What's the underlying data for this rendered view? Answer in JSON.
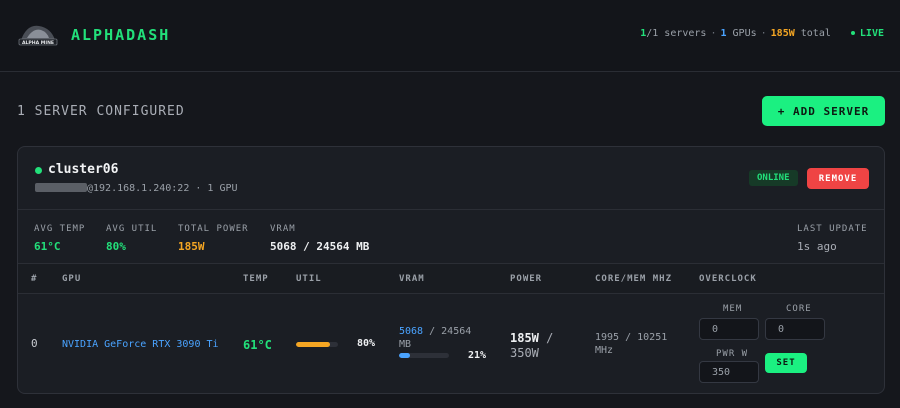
{
  "app": {
    "brand": "ALPHADASH",
    "logo_text": "ALPHA MINE",
    "stats": {
      "online": "1",
      "servers_total": "/1 servers",
      "gpus": "1",
      "gpus_label": " GPUs",
      "power": "185W",
      "power_label": " total",
      "live": "LIVE"
    }
  },
  "section": {
    "title": "1 SERVER CONFIGURED",
    "add_label": "+ ADD SERVER"
  },
  "server": {
    "name": "cluster06",
    "address": "@192.168.1.240:22 · 1 GPU",
    "status": "ONLINE",
    "remove_label": "REMOVE",
    "summary": {
      "avg_temp_label": "AVG TEMP",
      "avg_temp": "61°C",
      "avg_util_label": "AVG UTIL",
      "avg_util": "80%",
      "total_power_label": "TOTAL POWER",
      "total_power": "185W",
      "vram_label": "VRAM",
      "vram": "5068 / 24564 MB",
      "last_update_label": "LAST UPDATE",
      "last_update": "1s ago"
    },
    "columns": [
      "#",
      "GPU",
      "TEMP",
      "UTIL",
      "VRAM",
      "POWER",
      "CORE/MEM MHZ",
      "OVERCLOCK"
    ],
    "gpus": [
      {
        "index": "0",
        "name": "NVIDIA GeForce RTX 3090 Ti",
        "temp": "61°C",
        "util_pct": "80%",
        "util_fraction": 0.8,
        "vram_used": "5068",
        "vram_total": " / 24564 MB",
        "vram_pct": "21%",
        "vram_fraction": 0.21,
        "power_draw": "185W",
        "power_limit": " / 350W",
        "clocks": "1995 / 10251 MHz",
        "oc": {
          "mem_label": "MEM",
          "mem_value": "0",
          "core_label": "CORE",
          "core_value": "0",
          "pwr_label": "PWR W",
          "pwr_value": "350",
          "set_label": "SET"
        }
      }
    ]
  },
  "colors": {
    "accent": "#1bf081",
    "danger": "#ef4444",
    "info": "#4aa3ff",
    "warn": "#f5a623"
  }
}
